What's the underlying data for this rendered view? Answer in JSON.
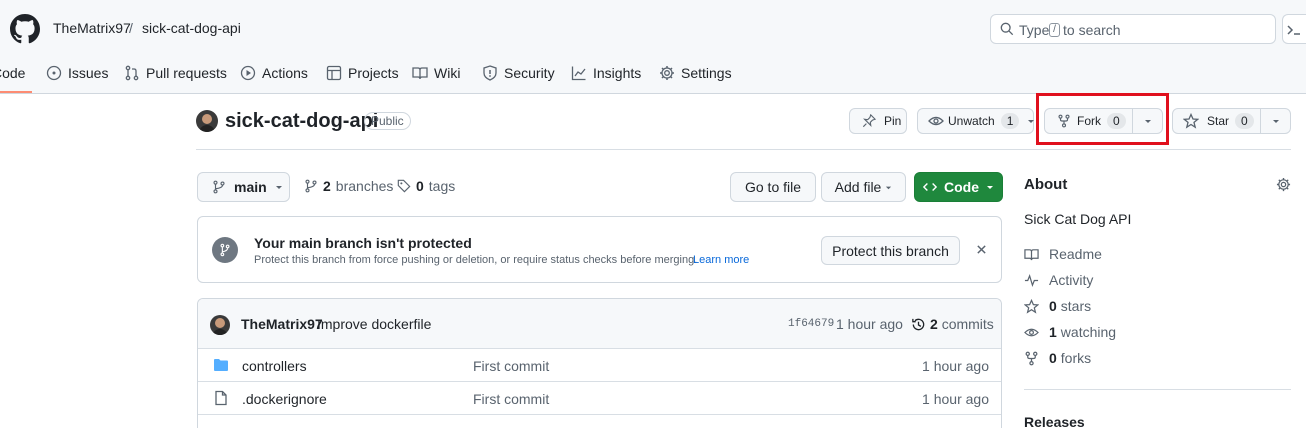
{
  "header": {
    "owner": "TheMatrix97",
    "separator": "/",
    "repo": "sick-cat-dog-api",
    "search_placeholder_pre": "Type",
    "search_key": "/",
    "search_placeholder_post": "to search"
  },
  "tabs": [
    {
      "label": "Code",
      "icon": "code-icon"
    },
    {
      "label": "Issues",
      "icon": "issue-icon"
    },
    {
      "label": "Pull requests",
      "icon": "pull-request-icon"
    },
    {
      "label": "Actions",
      "icon": "play-icon"
    },
    {
      "label": "Projects",
      "icon": "table-icon"
    },
    {
      "label": "Wiki",
      "icon": "book-icon"
    },
    {
      "label": "Security",
      "icon": "shield-icon"
    },
    {
      "label": "Insights",
      "icon": "graph-icon"
    },
    {
      "label": "Settings",
      "icon": "gear-icon"
    }
  ],
  "repo": {
    "name": "sick-cat-dog-api",
    "visibility": "Public",
    "pin_label": "Pin",
    "unwatch_label": "Unwatch",
    "watch_count": "1",
    "fork_label": "Fork",
    "fork_count": "0",
    "star_label": "Star",
    "star_count": "0"
  },
  "branch_bar": {
    "branch": "main",
    "branches_count": "2",
    "branches_label": "branches",
    "tags_count": "0",
    "tags_label": "tags",
    "goto_file": "Go to file",
    "add_file": "Add file",
    "code": "Code"
  },
  "protect": {
    "title": "Your main branch isn't protected",
    "desc": "Protect this branch from force pushing or deletion, or require status checks before merging.",
    "learn_more": "Learn more",
    "button": "Protect this branch"
  },
  "commit": {
    "author": "TheMatrix97",
    "message": "Improve dockerfile",
    "sha": "1f64679",
    "time": "1 hour ago",
    "count": "2",
    "count_label": "commits"
  },
  "files": [
    {
      "name": "controllers",
      "type": "folder",
      "message": "First commit",
      "time": "1 hour ago"
    },
    {
      "name": ".dockerignore",
      "type": "file",
      "message": "First commit",
      "time": "1 hour ago"
    }
  ],
  "about": {
    "title": "About",
    "description": "Sick Cat Dog API",
    "readme": "Readme",
    "activity": "Activity",
    "stars_count": "0",
    "stars_label": "stars",
    "watching_count": "1",
    "watching_label": "watching",
    "forks_count": "0",
    "forks_label": "forks",
    "releases": "Releases"
  },
  "colors": {
    "accent_green": "#1f883d",
    "highlight_red": "#e0101d",
    "link_blue": "#0969da",
    "folder_blue": "#54aeff"
  }
}
